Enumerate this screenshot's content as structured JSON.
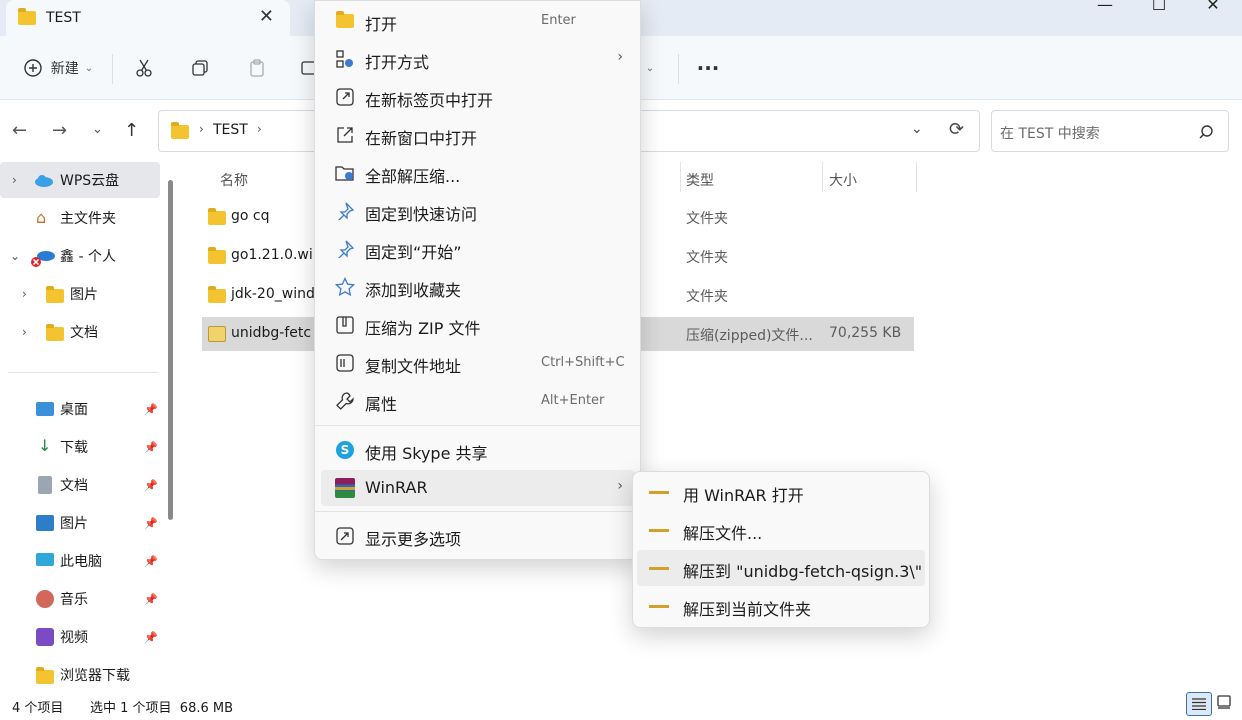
{
  "window": {
    "tab_title": "TEST",
    "minimize": "—",
    "maximize": "☐",
    "close": "✕"
  },
  "toolbar": {
    "new_label": "新建"
  },
  "address": {
    "path_item": "TEST",
    "search_placeholder": "在 TEST 中搜索"
  },
  "sidebar": {
    "items": [
      {
        "label": "WPS云盘"
      },
      {
        "label": "主文件夹"
      },
      {
        "label": "鑫 - 个人"
      },
      {
        "label": "图片"
      },
      {
        "label": "文档"
      }
    ],
    "quick": [
      {
        "label": "桌面"
      },
      {
        "label": "下载"
      },
      {
        "label": "文档"
      },
      {
        "label": "图片"
      },
      {
        "label": "此电脑"
      },
      {
        "label": "音乐"
      },
      {
        "label": "视频"
      },
      {
        "label": "浏览器下载"
      }
    ]
  },
  "columns": {
    "name": "名称",
    "type": "类型",
    "size": "大小"
  },
  "files": [
    {
      "name": "go cq",
      "type": "文件夹",
      "size": ""
    },
    {
      "name": "go1.21.0.wi",
      "type": "文件夹",
      "size": ""
    },
    {
      "name": "jdk-20_wind",
      "type": "文件夹",
      "size": ""
    },
    {
      "name": "unidbg-fetc",
      "type": "压缩(zipped)文件...",
      "size": "70,255 KB"
    }
  ],
  "status": {
    "count": "4 个项目",
    "selection": "选中 1 个项目  68.6 MB"
  },
  "context_menu": {
    "items": [
      {
        "label": "打开",
        "shortcut": "Enter"
      },
      {
        "label": "打开方式",
        "shortcut": ""
      },
      {
        "label": "在新标签页中打开",
        "shortcut": ""
      },
      {
        "label": "在新窗口中打开",
        "shortcut": ""
      },
      {
        "label": "全部解压缩...",
        "shortcut": ""
      },
      {
        "label": "固定到快速访问",
        "shortcut": ""
      },
      {
        "label": "固定到“开始”",
        "shortcut": ""
      },
      {
        "label": "添加到收藏夹",
        "shortcut": ""
      },
      {
        "label": "压缩为 ZIP 文件",
        "shortcut": ""
      },
      {
        "label": "复制文件地址",
        "shortcut": "Ctrl+Shift+C"
      },
      {
        "label": "属性",
        "shortcut": "Alt+Enter"
      },
      {
        "label": "使用 Skype 共享",
        "shortcut": ""
      },
      {
        "label": "WinRAR",
        "shortcut": ""
      },
      {
        "label": "显示更多选项",
        "shortcut": ""
      }
    ]
  },
  "winrar_submenu": {
    "items": [
      {
        "label": "用 WinRAR 打开"
      },
      {
        "label": "解压文件..."
      },
      {
        "label": "解压到 \"unidbg-fetch-qsign.3\\\""
      },
      {
        "label": "解压到当前文件夹"
      }
    ]
  }
}
